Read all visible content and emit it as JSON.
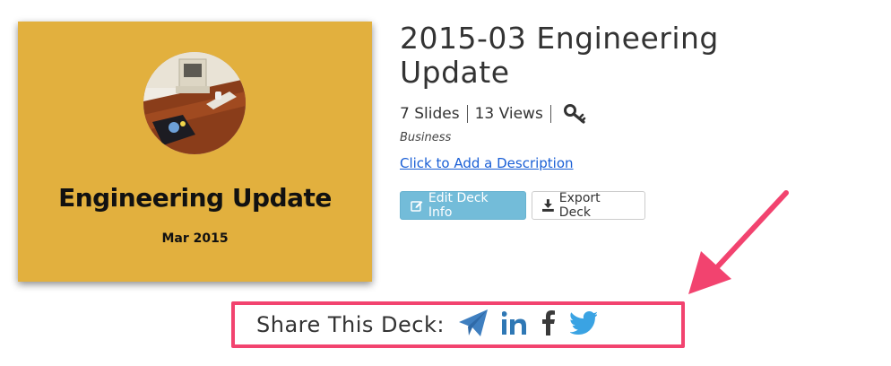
{
  "deck": {
    "thumbnail": {
      "title": "Engineering Update",
      "date": "Mar 2015",
      "background_color": "#e2b03e"
    },
    "title": "2015-03 Engineering Update",
    "slides_text": "7 Slides",
    "views_text": "13 Views",
    "category": "Business",
    "add_description_link": "Click to Add a Description"
  },
  "actions": {
    "edit_label": "Edit Deck Info",
    "export_label": "Export Deck"
  },
  "share": {
    "label": "Share This Deck:",
    "icons": [
      "send-icon",
      "linkedin-icon",
      "facebook-icon",
      "twitter-icon"
    ],
    "highlight_color": "#f2436f"
  },
  "colors": {
    "accent": "#73bcd9",
    "link": "#1a5fd6",
    "annotation": "#f2436f"
  }
}
